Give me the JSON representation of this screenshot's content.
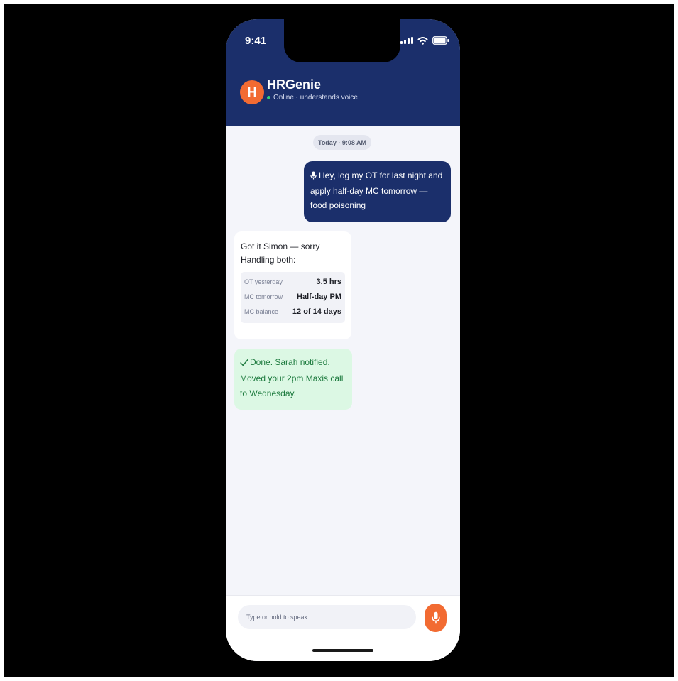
{
  "status_bar": {
    "time": "9:41",
    "icons": [
      "signal-icon",
      "wifi-icon",
      "battery-icon"
    ]
  },
  "header": {
    "avatar_letter": "H",
    "bot_name": "HRGenie",
    "status": "Online · understands voice"
  },
  "conversation": {
    "date_chip": "Today · 9:08 AM",
    "user_message": "Hey, log my OT for last night and apply half-day MC tomorrow — food poisoning",
    "bot_reply": {
      "line1": "Got it Simon — sorry",
      "line2": "Handling both:",
      "summary": [
        {
          "label": "OT yesterday",
          "value": "3.5 hrs"
        },
        {
          "label": "MC tomorrow",
          "value": "Half-day PM"
        },
        {
          "label": "MC balance",
          "value": "12 of 14 days"
        }
      ]
    },
    "confirmation": "Done. Sarah notified. Moved your 2pm Maxis call to Wednesday."
  },
  "composer": {
    "placeholder": "Type or hold to speak"
  },
  "colors": {
    "header_bg": "#1b2f6b",
    "accent_orange": "#f26b32",
    "success_bg": "#dcf8e4",
    "success_text": "#1d7a3e",
    "online_green": "#2fd27a"
  }
}
